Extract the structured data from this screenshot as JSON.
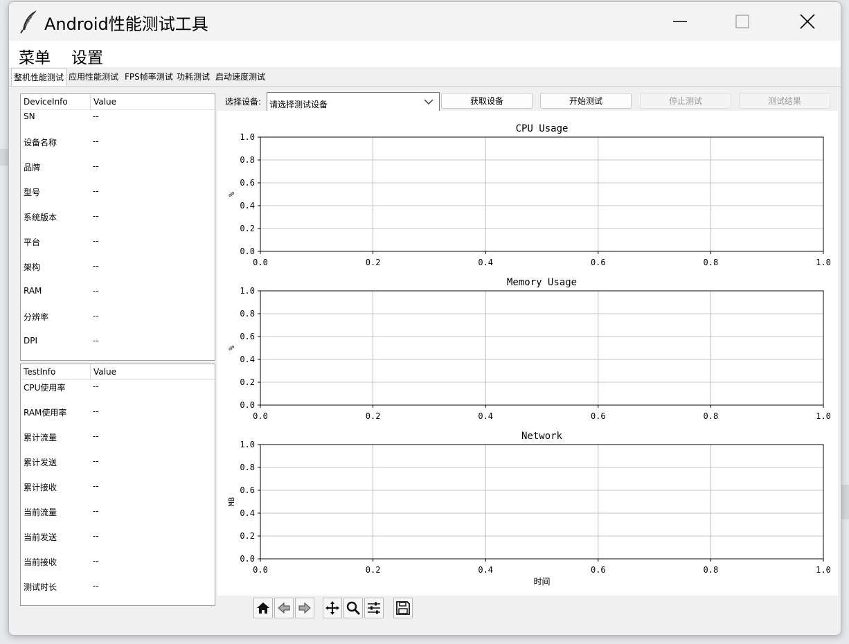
{
  "window": {
    "title": "Android性能测试工具"
  },
  "menu": [
    "菜单",
    "设置"
  ],
  "tabs": [
    "整机性能测试",
    "应用性能测试",
    "FPS帧率测试",
    "功耗测试",
    "启动速度测试"
  ],
  "device_table": {
    "headers": [
      "DeviceInfo",
      "Value"
    ],
    "rows": [
      [
        "SN",
        "--"
      ],
      [
        "设备名称",
        "--"
      ],
      [
        "品牌",
        "--"
      ],
      [
        "型号",
        "--"
      ],
      [
        "系统版本",
        "--"
      ],
      [
        "平台",
        "--"
      ],
      [
        "架构",
        "--"
      ],
      [
        "RAM",
        "--"
      ],
      [
        "分辨率",
        "--"
      ],
      [
        "DPI",
        "--"
      ]
    ]
  },
  "test_table": {
    "headers": [
      "TestInfo",
      "Value"
    ],
    "rows": [
      [
        "CPU使用率",
        "--"
      ],
      [
        "RAM使用率",
        "--"
      ],
      [
        "累计流量",
        "--"
      ],
      [
        "累计发送",
        "--"
      ],
      [
        "累计接收",
        "--"
      ],
      [
        "当前流量",
        "--"
      ],
      [
        "当前发送",
        "--"
      ],
      [
        "当前接收",
        "--"
      ],
      [
        "测试时长",
        "--"
      ]
    ]
  },
  "controls": {
    "select_label": "选择设备:",
    "select_value": "请选择测试设备",
    "buttons": [
      {
        "label": "获取设备",
        "enabled": true
      },
      {
        "label": "开始测试",
        "enabled": true
      },
      {
        "label": "停止测试",
        "enabled": false
      },
      {
        "label": "测试结果",
        "enabled": false
      }
    ]
  },
  "chart_data": [
    {
      "type": "line",
      "title": "CPU Usage",
      "xlabel": "",
      "ylabel": "%",
      "xlim": [
        0,
        1
      ],
      "ylim": [
        0,
        1
      ],
      "xticks": [
        "0.0",
        "0.2",
        "0.4",
        "0.6",
        "0.8",
        "1.0"
      ],
      "yticks": [
        "0.0",
        "0.2",
        "0.4",
        "0.6",
        "0.8",
        "1.0"
      ],
      "grid": true,
      "series": []
    },
    {
      "type": "line",
      "title": "Memory Usage",
      "xlabel": "",
      "ylabel": "%",
      "xlim": [
        0,
        1
      ],
      "ylim": [
        0,
        1
      ],
      "xticks": [
        "0.0",
        "0.2",
        "0.4",
        "0.6",
        "0.8",
        "1.0"
      ],
      "yticks": [
        "0.0",
        "0.2",
        "0.4",
        "0.6",
        "0.8",
        "1.0"
      ],
      "grid": true,
      "series": []
    },
    {
      "type": "line",
      "title": "Network",
      "xlabel": "时间",
      "ylabel": "MB",
      "xlim": [
        0,
        1
      ],
      "ylim": [
        0,
        1
      ],
      "xticks": [
        "0.0",
        "0.2",
        "0.4",
        "0.6",
        "0.8",
        "1.0"
      ],
      "yticks": [
        "0.0",
        "0.2",
        "0.4",
        "0.6",
        "0.8",
        "1.0"
      ],
      "grid": true,
      "series": []
    }
  ],
  "plot_toolbar": [
    "home-icon",
    "back-arrow-icon",
    "forward-arrow-icon",
    "pan-icon",
    "zoom-icon",
    "configure-subplots-icon",
    "save-icon"
  ]
}
